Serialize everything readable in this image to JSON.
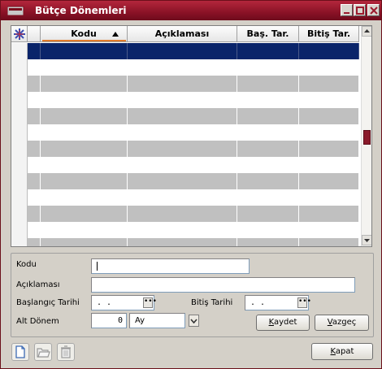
{
  "window": {
    "title": "Bütçe Dönemleri"
  },
  "grid": {
    "columns": [
      "Kodu",
      "Açıklaması",
      "Baş. Tar.",
      "Bitiş  Tar."
    ],
    "sort_column": "Kodu",
    "row_count": 13,
    "selected_row": 0
  },
  "form": {
    "kodu_label": "Kodu",
    "kodu_value": "",
    "aciklama_label": "Açıklaması",
    "aciklama_value": "",
    "baslangic_label": "Başlangıç Tarihi",
    "baslangic_value": ". .",
    "bitis_label": "Bitiş Tarihi",
    "bitis_value": ". .",
    "alt_donem_label": "Alt Dönem",
    "alt_donem_value": "0",
    "period_unit": "Ay",
    "kaydet_label": "Kaydet",
    "vazgec_label": "Vazgeç"
  },
  "footer": {
    "kapat_label": "Kapat"
  },
  "colors": {
    "title_bar": "#8a1226",
    "selected_row": "#0a246a",
    "row_alt": "#c0c0c0",
    "scroll_thumb": "#8a1a2b"
  }
}
